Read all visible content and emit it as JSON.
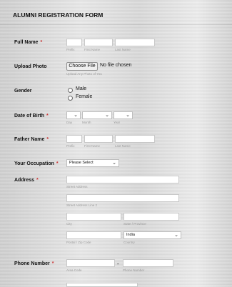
{
  "form": {
    "title": "ALUMNI REGISTRATION FORM"
  },
  "fullname": {
    "label": "Full Name",
    "required": "*",
    "sublabels": [
      "Prefix",
      "First Name",
      "Last Name"
    ]
  },
  "upload": {
    "label": "Upload Photo",
    "button": "Choose File",
    "status": "No file chosen",
    "sublabel": "Upload Any Photo of You"
  },
  "gender": {
    "label": "Gender",
    "options": [
      "Male",
      "Female"
    ]
  },
  "dob": {
    "label": "Date of Birth",
    "required": "*",
    "sublabels": [
      "Day",
      "Month",
      "Year"
    ]
  },
  "father": {
    "label": "Father Name",
    "required": "*",
    "sublabels": [
      "Prefix",
      "First Name",
      "Last Name"
    ]
  },
  "occupation": {
    "label": "Your Occupation",
    "required": "*",
    "selected": "Please Select"
  },
  "address": {
    "label": "Address",
    "required": "*",
    "sublabels": [
      "Street Address",
      "Street Address Line 2",
      "City",
      "State / Province",
      "Postal / Zip Code",
      "Country"
    ],
    "country": "India"
  },
  "phone": {
    "label": "Phone Number",
    "required": "*",
    "separator": "-",
    "sublabels": [
      "Area Code",
      "Phone Number"
    ]
  },
  "icons": {
    "caret": "chevron-down-icon",
    "radio": "radio-circle-icon"
  }
}
